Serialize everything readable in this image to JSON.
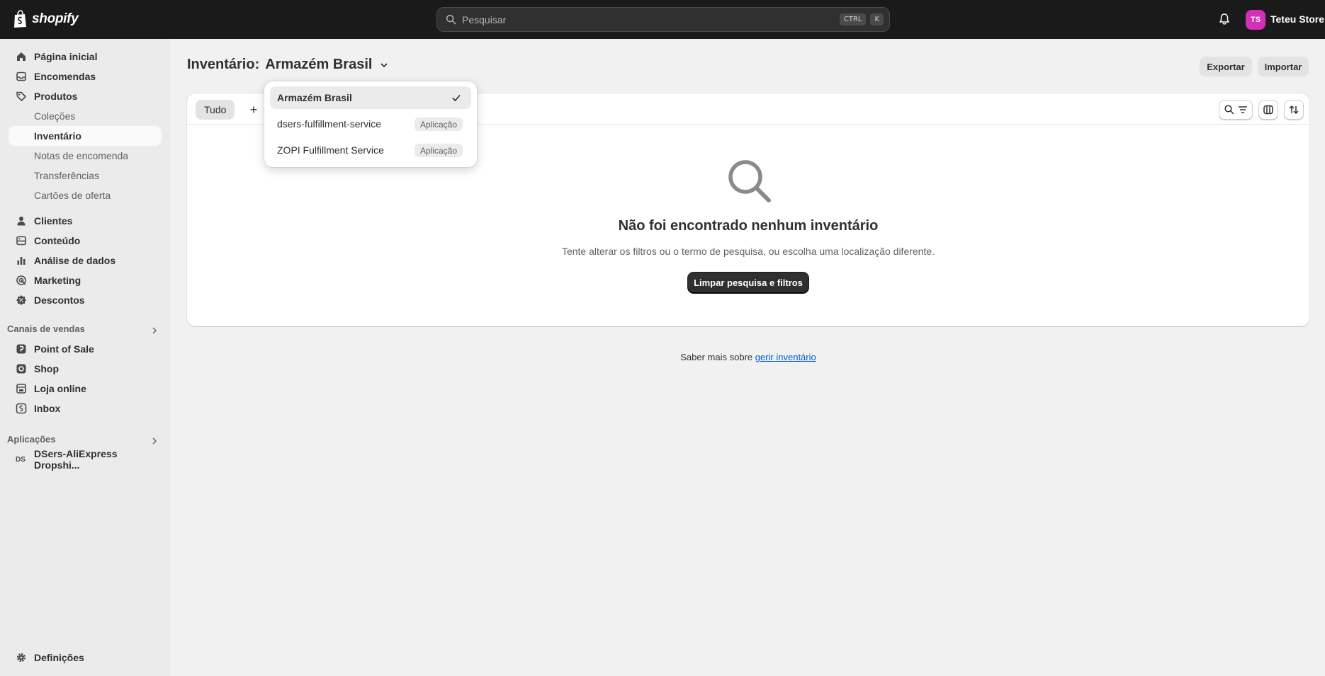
{
  "topbar": {
    "logo_text": "shopify",
    "search_placeholder": "Pesquisar",
    "shortcut_keys": [
      "CTRL",
      "K"
    ],
    "avatar_initials": "TS",
    "store_name": "Teteu Store",
    "avatar_color": "#d430b7"
  },
  "sidebar": {
    "items": [
      {
        "label": "Página inicial",
        "icon": "home-icon"
      },
      {
        "label": "Encomendas",
        "icon": "inbox-icon"
      },
      {
        "label": "Produtos",
        "icon": "tag-icon"
      },
      {
        "label": "Coleções"
      },
      {
        "label": "Inventário"
      },
      {
        "label": "Notas de encomenda"
      },
      {
        "label": "Transferências"
      },
      {
        "label": "Cartões de oferta"
      },
      {
        "label": "Clientes",
        "icon": "person-icon"
      },
      {
        "label": "Conteúdo",
        "icon": "content-icon"
      },
      {
        "label": "Análise de dados",
        "icon": "bar-chart-icon"
      },
      {
        "label": "Marketing",
        "icon": "target-icon"
      },
      {
        "label": "Descontos",
        "icon": "discount-icon"
      }
    ],
    "sales_channels_title": "Canais de vendas",
    "sales_channels": [
      {
        "label": "Point of Sale",
        "icon": "pos-icon"
      },
      {
        "label": "Shop",
        "icon": "shop-icon"
      },
      {
        "label": "Loja online",
        "icon": "store-icon"
      },
      {
        "label": "Inbox",
        "icon": "chat-icon"
      }
    ],
    "apps_title": "Aplicações",
    "apps": [
      {
        "label": "DSers-AliExpress Dropshi...",
        "icon_text": "DS"
      }
    ],
    "settings_label": "Definições"
  },
  "main": {
    "title": "Inventário:",
    "location": "Armazém Brasil",
    "export_label": "Exportar",
    "import_label": "Importar",
    "tab_all": "Tudo",
    "tab_add": "+",
    "empty_title": "Não foi encontrado nenhum inventário",
    "empty_desc": "Tente alterar os filtros ou o termo de pesquisa, ou escolha uma localização diferente.",
    "clear_button": "Limpar pesquisa e filtros",
    "learn_text": "Saber mais sobre ",
    "learn_link": "gerir inventário"
  },
  "location_dropdown": {
    "options": [
      {
        "label": "Armazém Brasil",
        "selected": true
      },
      {
        "label": "dsers-fulfillment-service",
        "badge": "Aplicação"
      },
      {
        "label": "ZOPI Fulfillment Service",
        "badge": "Aplicação"
      }
    ]
  }
}
